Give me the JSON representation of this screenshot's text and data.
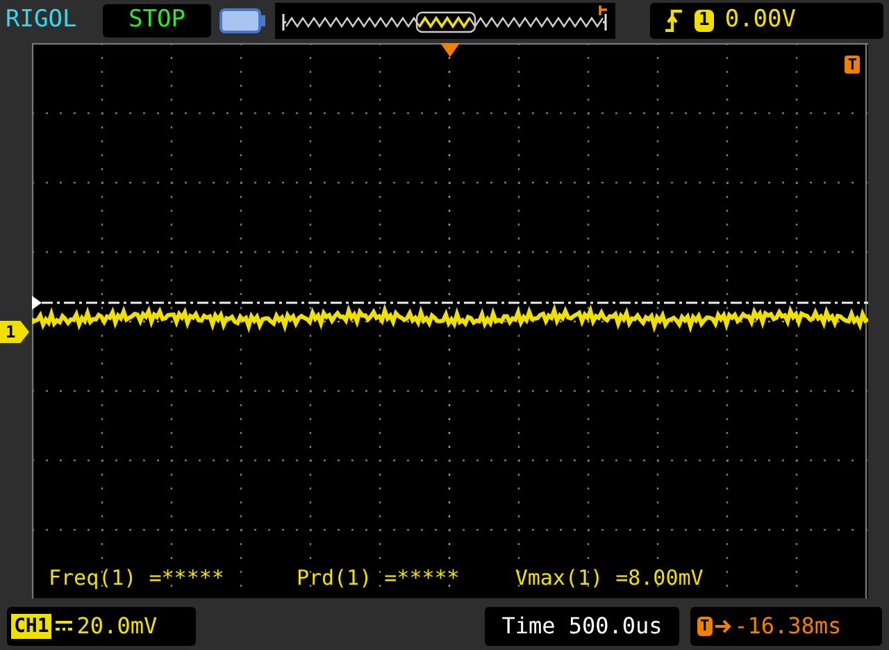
{
  "brand": "RIGOL",
  "run_state": "STOP",
  "trigger": {
    "source": "1",
    "level": "0.00V"
  },
  "trigger_marker": "T",
  "channel_marker": "1",
  "measurements": [
    {
      "label": "Freq(1)",
      "value": "=*****"
    },
    {
      "label": "Prd(1)",
      "value": "=*****"
    },
    {
      "label": "Vmax(1)",
      "value": "=8.00mV"
    }
  ],
  "channel": {
    "name": "CH1",
    "scale": "20.0mV"
  },
  "timebase": {
    "label": "Time",
    "value": "500.0us"
  },
  "trigger_offset": {
    "marker": "T",
    "value": "-16.38ms"
  }
}
